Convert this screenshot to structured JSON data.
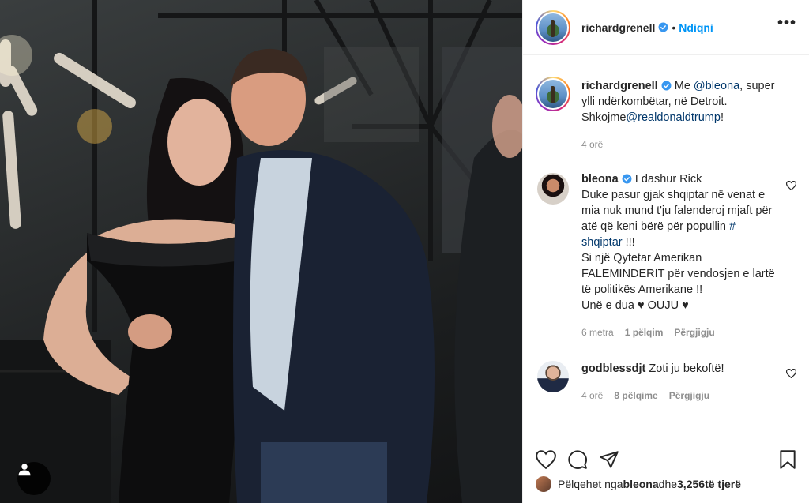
{
  "post": {
    "author": "richardgrenell",
    "dot": "•",
    "follow_label": "Ndiqni",
    "more_label": "•••"
  },
  "caption": {
    "user": "richardgrenell",
    "text_pre": "Me ",
    "mention1": "@bleona",
    "text_mid": ", super ylli ndërkombëtar, në Detroit. Shkojme",
    "mention2": "@realdonaldtrump",
    "text_post": "!",
    "time": "4 orë"
  },
  "comments": [
    {
      "user": "bleona",
      "text_lines": [
        "I dashur Rick",
        "Duke pasur gjak shqiptar në venat e mia nuk mund t'ju falenderoj mjaft për",
        "atë që keni bërë për popullin ",
        "!!!",
        "Si një Qytetar Amerikan FALEMINDERIT për vendosjen e lartë të politikës Amerikane !!",
        "Unë e dua ♥ OUJU ♥"
      ],
      "hashtag": "# shqiptar",
      "time": "6 metra",
      "likes": "1 pëlqim",
      "reply": "Përgjigju"
    },
    {
      "user": "godblessdjt",
      "text": "Zoti ju bekoftë!",
      "time": "4 orë",
      "likes": "8 pëlqime",
      "reply": "Përgjigju"
    }
  ],
  "liked_by": {
    "prefix": "Pëlqehet nga ",
    "user": "bleona",
    "mid": " dhe ",
    "count": "3,256",
    "suffix": " të tjerë"
  },
  "colors": {
    "accent": "#0095f6",
    "mention": "#00376b",
    "muted": "#8e8e8e",
    "verified": "#3897f0"
  },
  "icons": [
    "verified-badge-icon",
    "heart-icon",
    "comment-icon",
    "share-icon",
    "bookmark-icon",
    "user-tag-icon",
    "more-icon"
  ]
}
